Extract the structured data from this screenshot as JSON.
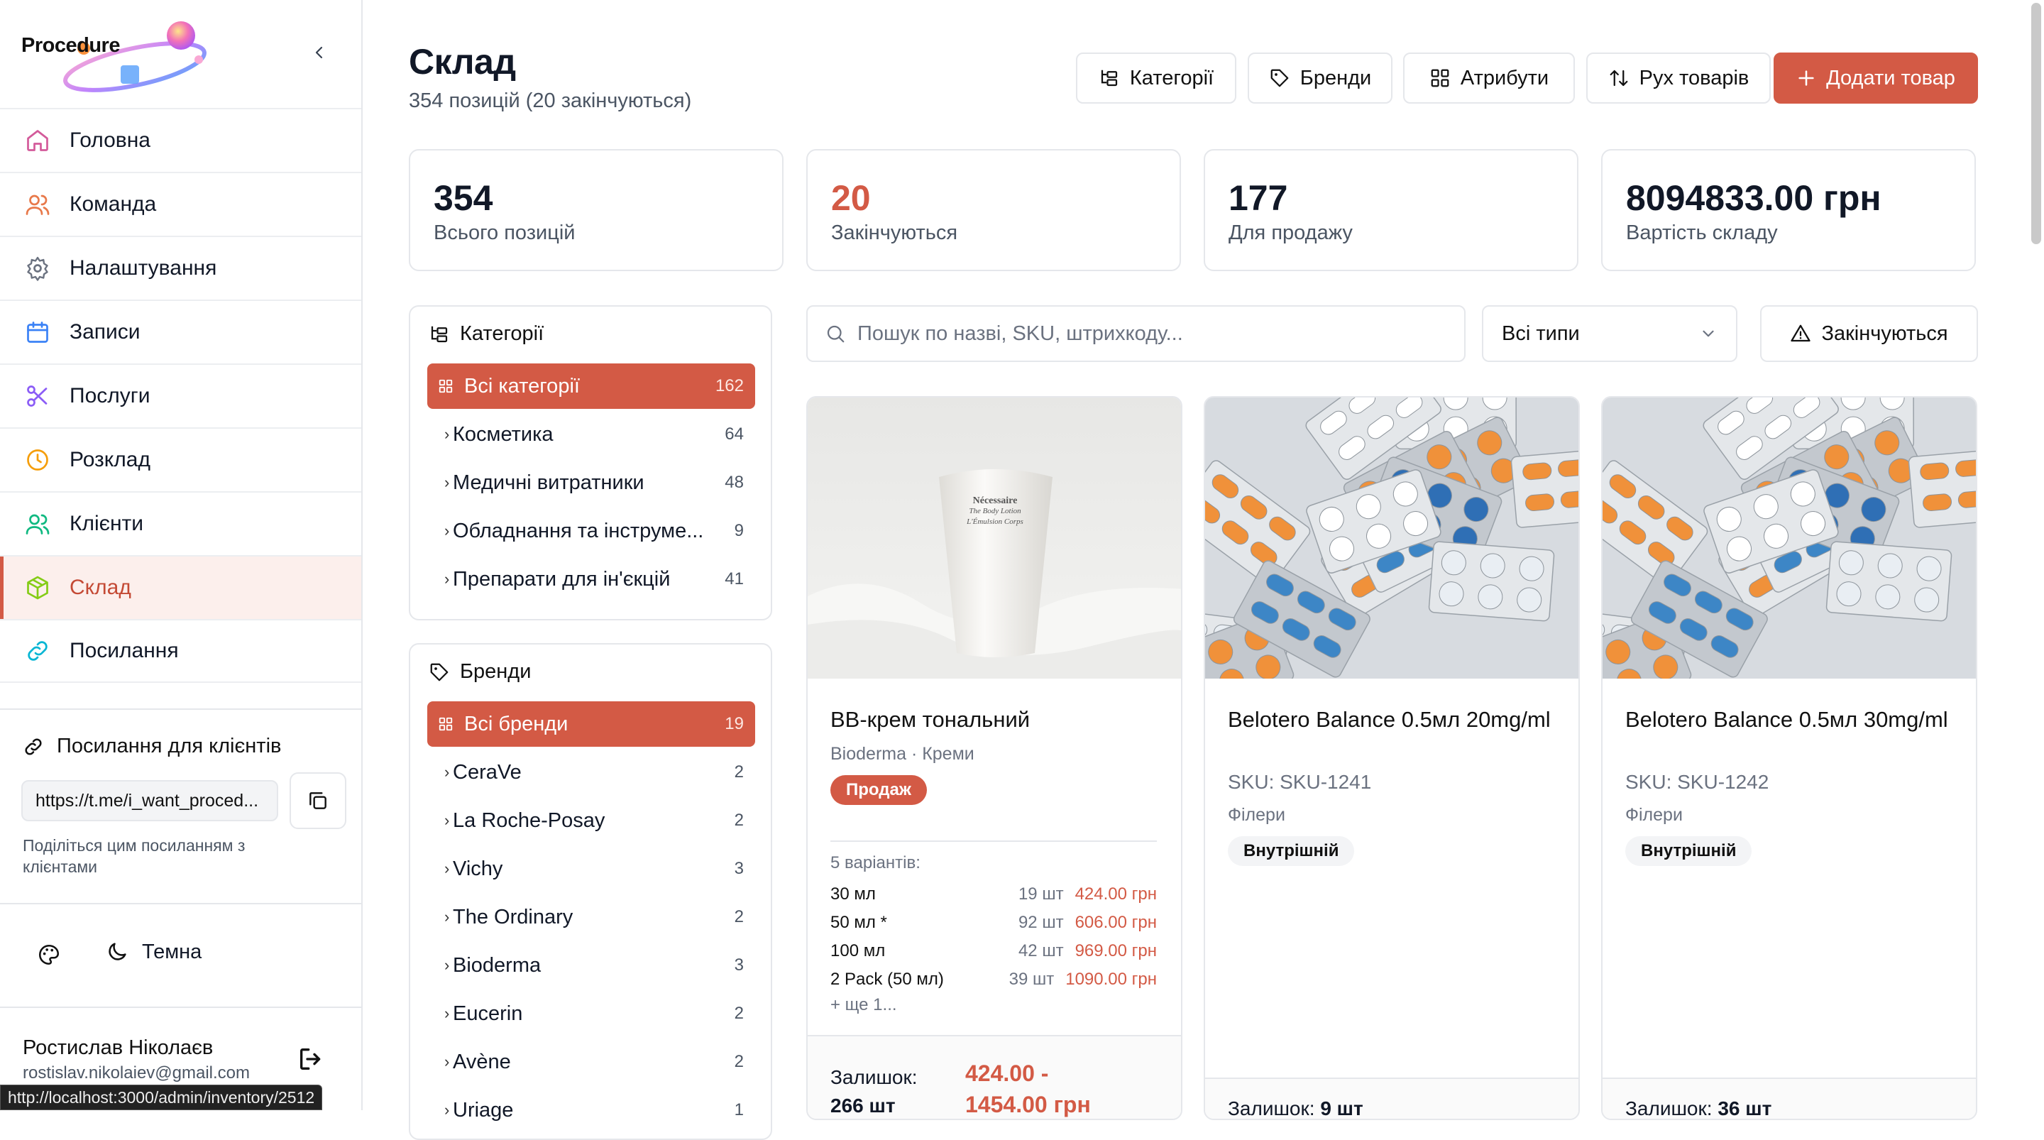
{
  "app": {
    "logo_text": "Procedure"
  },
  "nav": [
    {
      "label": "Головна",
      "icon": "home-icon",
      "color": "#d35a9a"
    },
    {
      "label": "Команда",
      "icon": "users-icon",
      "color": "#e8794a"
    },
    {
      "label": "Налаштування",
      "icon": "gear-icon",
      "color": "#6b7280"
    },
    {
      "label": "Записи",
      "icon": "calendar-icon",
      "color": "#3b82f6"
    },
    {
      "label": "Послуги",
      "icon": "scissors-icon",
      "color": "#8b5cf6"
    },
    {
      "label": "Розклад",
      "icon": "clock-icon",
      "color": "#f59e0b"
    },
    {
      "label": "Клієнти",
      "icon": "clients-icon",
      "color": "#10b981"
    },
    {
      "label": "Склад",
      "icon": "box-icon",
      "color": "#84cc16"
    },
    {
      "label": "Посилання",
      "icon": "link-icon",
      "color": "#06b6d4"
    }
  ],
  "client_link": {
    "title": "Посилання для клієнтів",
    "url": "https://t.me/i_want_proced...",
    "hint": "Поділіться цим посиланням з клієнтами"
  },
  "theme": {
    "label": "Темна"
  },
  "user": {
    "name": "Ростислав Ніколаєв",
    "email": "rostislav.nikolaiev@gmail.com"
  },
  "status_url": "http://localhost:3000/admin/inventory/2512",
  "header": {
    "title": "Склад",
    "subtitle": "354 позицій (20 закінчуються)",
    "buttons": {
      "categories": "Категорії",
      "brands": "Бренди",
      "attributes": "Атрибути",
      "movement": "Рух товарів",
      "add": "Додати товар"
    }
  },
  "stats": [
    {
      "value": "354",
      "label": "Всього позицій"
    },
    {
      "value": "20",
      "label": "Закінчуються",
      "color": "#d35a45"
    },
    {
      "value": "177",
      "label": "Для продажу"
    },
    {
      "value": "8094833.00 грн",
      "label": "Вартість складу"
    }
  ],
  "categories": {
    "title": "Категорії",
    "all": {
      "label": "Всі категорії",
      "count": "162"
    },
    "items": [
      {
        "label": "Косметика",
        "count": "64"
      },
      {
        "label": "Медичні витратники",
        "count": "48"
      },
      {
        "label": "Обладнання та інструме...",
        "count": "9"
      },
      {
        "label": "Препарати для ін'єкцій",
        "count": "41"
      }
    ]
  },
  "brands": {
    "title": "Бренди",
    "all": {
      "label": "Всі бренди",
      "count": "19"
    },
    "items": [
      {
        "label": "CeraVe",
        "count": "2"
      },
      {
        "label": "La Roche-Posay",
        "count": "2"
      },
      {
        "label": "Vichy",
        "count": "3"
      },
      {
        "label": "The Ordinary",
        "count": "2"
      },
      {
        "label": "Bioderma",
        "count": "3"
      },
      {
        "label": "Eucerin",
        "count": "2"
      },
      {
        "label": "Avène",
        "count": "2"
      },
      {
        "label": "Uriage",
        "count": "1"
      }
    ]
  },
  "search": {
    "placeholder": "Пошук по назві, SKU, штрихкоду..."
  },
  "type_filter": {
    "value": "Всі типи"
  },
  "low_stock_button": "Закінчуються",
  "products": [
    {
      "name": "BB-крем тональний",
      "meta": "Bioderma · Креми",
      "badge": "Продаж",
      "image_text": [
        "Nécessaire",
        "The Body Lotion",
        "L'Émulsion Corps"
      ],
      "variants_header": "5 варіантів:",
      "variants": [
        {
          "name": "30 мл",
          "qty": "19 шт",
          "price": "424.00 грн"
        },
        {
          "name": "50 мл *",
          "qty": "92 шт",
          "price": "606.00 грн"
        },
        {
          "name": "100 мл",
          "qty": "42 шт",
          "price": "969.00 грн"
        },
        {
          "name": "2 Pack (50 мл)",
          "qty": "39 шт",
          "price": "1090.00 грн"
        }
      ],
      "more": "+ ще 1...",
      "stock_label": "Залишок:",
      "stock_value": "266 шт",
      "price_range": [
        "424.00 -",
        "1454.00 грн"
      ]
    },
    {
      "name": "Belotero Balance 0.5мл 20mg/ml",
      "sku": "SKU: SKU-1241",
      "category": "Філери",
      "badge": "Внутрішній",
      "stock_label": "Залишок:",
      "stock_value": "9 шт"
    },
    {
      "name": "Belotero Balance 0.5мл 30mg/ml",
      "sku": "SKU: SKU-1242",
      "category": "Філери",
      "badge": "Внутрішній",
      "stock_label": "Залишок:",
      "stock_value": "36 шт"
    }
  ],
  "colors": {
    "accent": "#d35a45",
    "active_bg": "#fcefec"
  }
}
